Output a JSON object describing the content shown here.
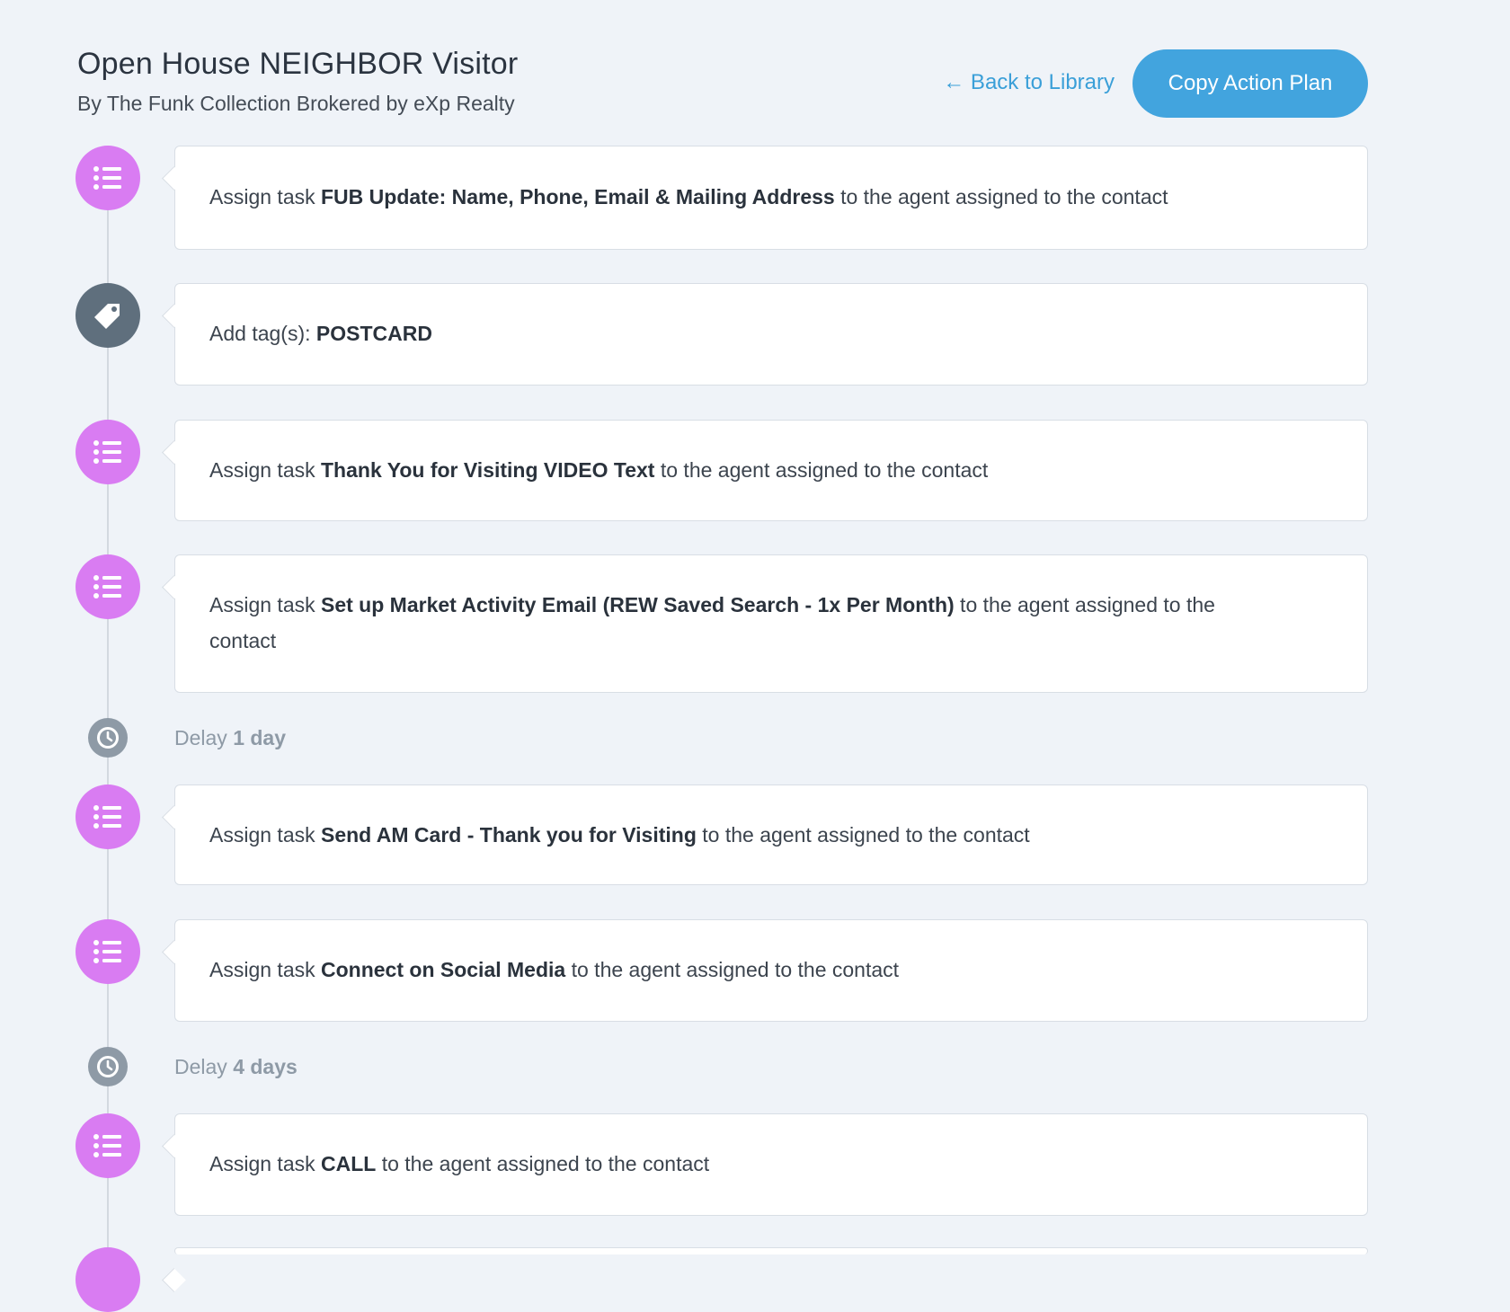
{
  "header": {
    "title": "Open House NEIGHBOR Visitor",
    "subtitle": "By The Funk Collection Brokered by eXp Realty",
    "back_link": "← Back to Library",
    "copy_button": "Copy Action Plan"
  },
  "steps": [
    {
      "type": "task",
      "icon": "task-list-icon",
      "prefix": "Assign task ",
      "bold": "FUB Update: Name, Phone, Email & Mailing Address",
      "suffix": " to the agent assigned to the contact"
    },
    {
      "type": "tag",
      "icon": "tag-icon",
      "prefix": "Add tag(s): ",
      "bold": "POSTCARD",
      "suffix": ""
    },
    {
      "type": "task",
      "icon": "task-list-icon",
      "prefix": "Assign task ",
      "bold": "Thank You for Visiting VIDEO Text",
      "suffix": " to the agent assigned to the contact"
    },
    {
      "type": "task",
      "icon": "task-list-icon",
      "prefix": "Assign task ",
      "bold": "Set up Market Activity Email (REW Saved Search - 1x Per Month)",
      "suffix": " to the agent assigned to the contact"
    },
    {
      "type": "task",
      "icon": "task-list-icon",
      "prefix": "Assign task ",
      "bold": "Send AM Card - Thank you for Visiting",
      "suffix": " to the agent assigned to the contact"
    },
    {
      "type": "task",
      "icon": "task-list-icon",
      "prefix": "Assign task ",
      "bold": "Connect on Social Media",
      "suffix": " to the agent assigned to the contact"
    },
    {
      "type": "task",
      "icon": "task-list-icon",
      "prefix": "Assign task ",
      "bold": "CALL",
      "suffix": " to the agent assigned to the contact"
    }
  ],
  "delays": [
    {
      "label": "Delay ",
      "value": "1 day",
      "icon": "clock-icon"
    },
    {
      "label": "Delay ",
      "value": "4 days",
      "icon": "clock-icon"
    }
  ],
  "colors": {
    "task_icon": "#d97cf2",
    "tag_icon": "#5f6f7d",
    "delay_icon": "#8e9aa6",
    "accent": "#42a4de"
  }
}
